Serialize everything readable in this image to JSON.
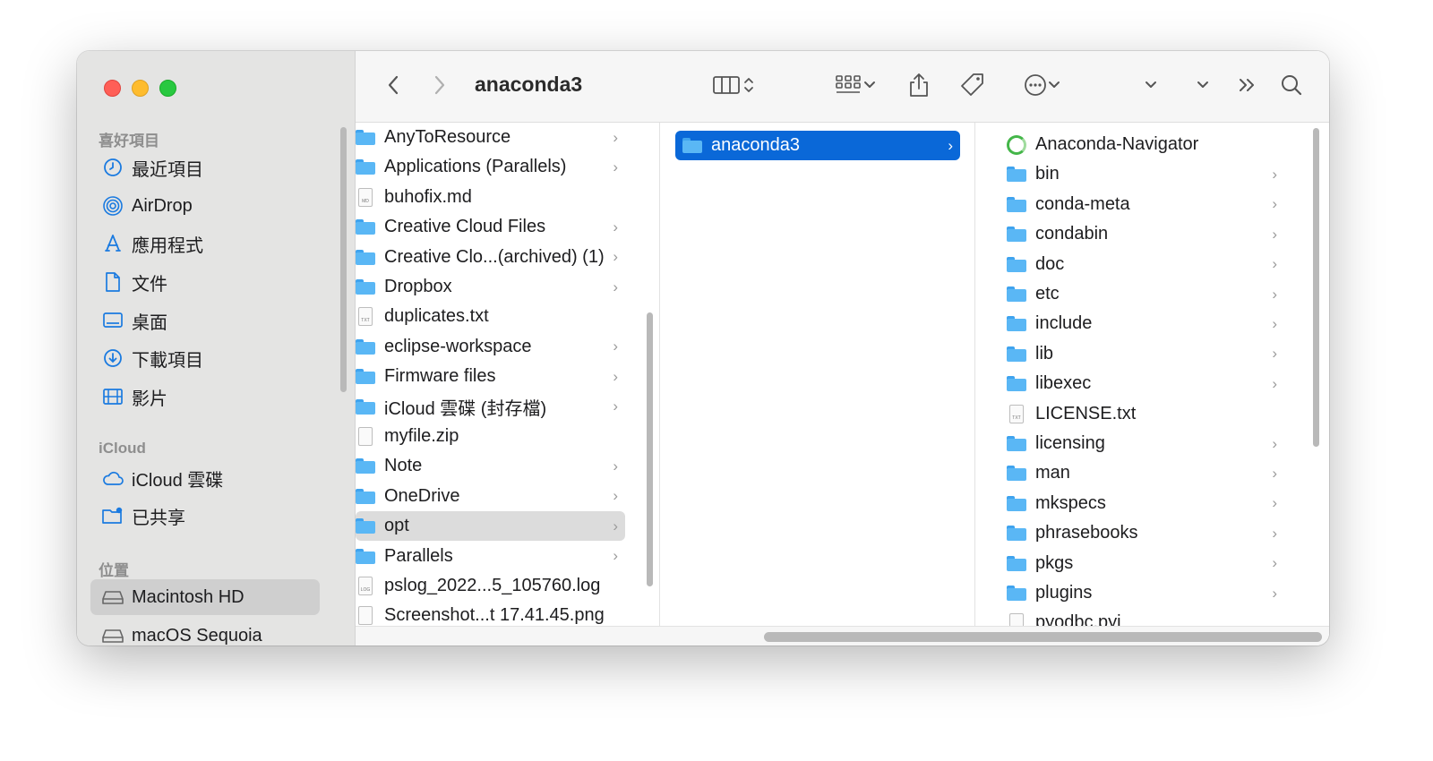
{
  "window": {
    "title": "anaconda3"
  },
  "sidebar": {
    "sections": [
      {
        "title": "喜好項目",
        "items": [
          {
            "label": "最近項目",
            "icon": "clock-icon"
          },
          {
            "label": "AirDrop",
            "icon": "airdrop-icon"
          },
          {
            "label": "應用程式",
            "icon": "applications-icon"
          },
          {
            "label": "文件",
            "icon": "document-icon"
          },
          {
            "label": "桌面",
            "icon": "desktop-icon"
          },
          {
            "label": "下載項目",
            "icon": "download-icon"
          },
          {
            "label": "影片",
            "icon": "film-icon"
          }
        ]
      },
      {
        "title": "iCloud",
        "items": [
          {
            "label": "iCloud 雲碟",
            "icon": "cloud-icon"
          },
          {
            "label": "已共享",
            "icon": "shared-folder-icon"
          }
        ]
      },
      {
        "title": "位置",
        "items": [
          {
            "label": "Macintosh HD",
            "icon": "disk-icon",
            "selected": true
          },
          {
            "label": "macOS Sequoia",
            "icon": "disk-icon"
          }
        ]
      }
    ]
  },
  "column1": [
    {
      "name": "AnyToResource",
      "kind": "folder",
      "chevron": true
    },
    {
      "name": "Applications (Parallels)",
      "kind": "folder",
      "chevron": true
    },
    {
      "name": "buhofix.md",
      "kind": "file",
      "badge": "MD"
    },
    {
      "name": "Creative Cloud Files",
      "kind": "folder",
      "chevron": true
    },
    {
      "name": "Creative Clo...(archived) (1)",
      "kind": "folder",
      "chevron": true
    },
    {
      "name": "Dropbox",
      "kind": "folder",
      "chevron": true
    },
    {
      "name": "duplicates.txt",
      "kind": "file",
      "badge": "TXT"
    },
    {
      "name": "eclipse-workspace",
      "kind": "folder",
      "chevron": true
    },
    {
      "name": "Firmware files",
      "kind": "folder",
      "chevron": true
    },
    {
      "name": "iCloud 雲碟 (封存檔)",
      "kind": "folder",
      "chevron": true
    },
    {
      "name": "myfile.zip",
      "kind": "file",
      "badge": ""
    },
    {
      "name": "Note",
      "kind": "folder",
      "chevron": true
    },
    {
      "name": "OneDrive",
      "kind": "folder",
      "chevron": true
    },
    {
      "name": "opt",
      "kind": "folder",
      "chevron": true,
      "highlight": "gray"
    },
    {
      "name": "Parallels",
      "kind": "folder",
      "chevron": true
    },
    {
      "name": "pslog_2022...5_105760.log",
      "kind": "file",
      "badge": "LOG"
    },
    {
      "name": "Screenshot...t 17.41.45.png",
      "kind": "file",
      "badge": ""
    }
  ],
  "column2": [
    {
      "name": "anaconda3",
      "kind": "folder",
      "chevron": true,
      "highlight": "blue"
    }
  ],
  "column3": [
    {
      "name": "Anaconda-Navigator",
      "kind": "app",
      "chevron": false
    },
    {
      "name": "bin",
      "kind": "folder",
      "chevron": true
    },
    {
      "name": "conda-meta",
      "kind": "folder",
      "chevron": true
    },
    {
      "name": "condabin",
      "kind": "folder",
      "chevron": true
    },
    {
      "name": "doc",
      "kind": "folder",
      "chevron": true
    },
    {
      "name": "etc",
      "kind": "folder",
      "chevron": true
    },
    {
      "name": "include",
      "kind": "folder",
      "chevron": true
    },
    {
      "name": "lib",
      "kind": "folder",
      "chevron": true
    },
    {
      "name": "libexec",
      "kind": "folder",
      "chevron": true
    },
    {
      "name": "LICENSE.txt",
      "kind": "file",
      "badge": "TXT"
    },
    {
      "name": "licensing",
      "kind": "folder",
      "chevron": true
    },
    {
      "name": "man",
      "kind": "folder",
      "chevron": true
    },
    {
      "name": "mkspecs",
      "kind": "folder",
      "chevron": true
    },
    {
      "name": "phrasebooks",
      "kind": "folder",
      "chevron": true
    },
    {
      "name": "pkgs",
      "kind": "folder",
      "chevron": true
    },
    {
      "name": "plugins",
      "kind": "folder",
      "chevron": true
    },
    {
      "name": "pyodbc.pyi",
      "kind": "file",
      "badge": ""
    }
  ],
  "glyphs": {
    "chevron": "›",
    "grip": "||"
  }
}
